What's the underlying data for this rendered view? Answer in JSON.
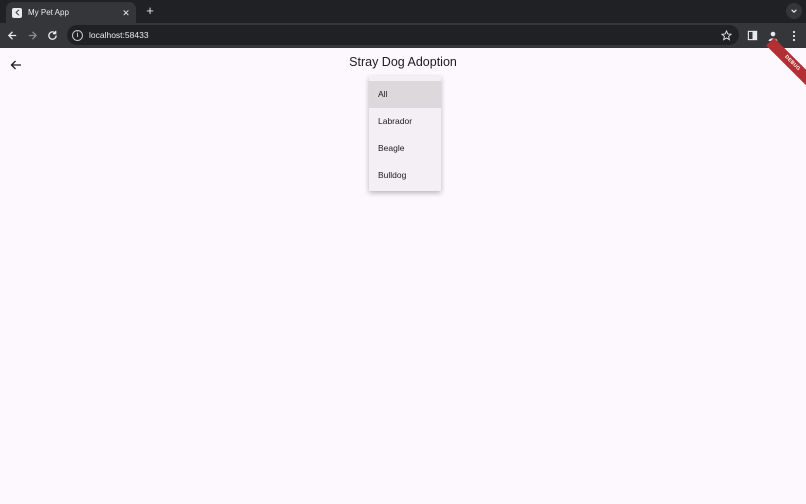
{
  "browser": {
    "tab_title": "My Pet App",
    "tab_close": "✕",
    "new_tab": "+",
    "url": "localhost:58433"
  },
  "app": {
    "title": "Stray Dog Adoption",
    "debug_banner": "DEBUG"
  },
  "dropdown": {
    "selected": "All",
    "options": [
      "All",
      "Labrador",
      "Beagle",
      "Bulldog"
    ]
  },
  "icons": {
    "browser": [
      "favicon-icon",
      "back-icon",
      "forward-icon",
      "reload-icon",
      "info-icon",
      "star-icon",
      "sidebar-icon",
      "profile-icon",
      "menu-icon",
      "tab-search-icon"
    ],
    "app": [
      "arrow-back-icon"
    ]
  },
  "colors": {
    "app_background": "#fdf8fd",
    "menu_background": "#f4eff4",
    "selected_item": "#dcd8dc",
    "debug_banner": "#b22f33",
    "chrome_dark": "#202124",
    "chrome_toolbar": "#35363a"
  }
}
